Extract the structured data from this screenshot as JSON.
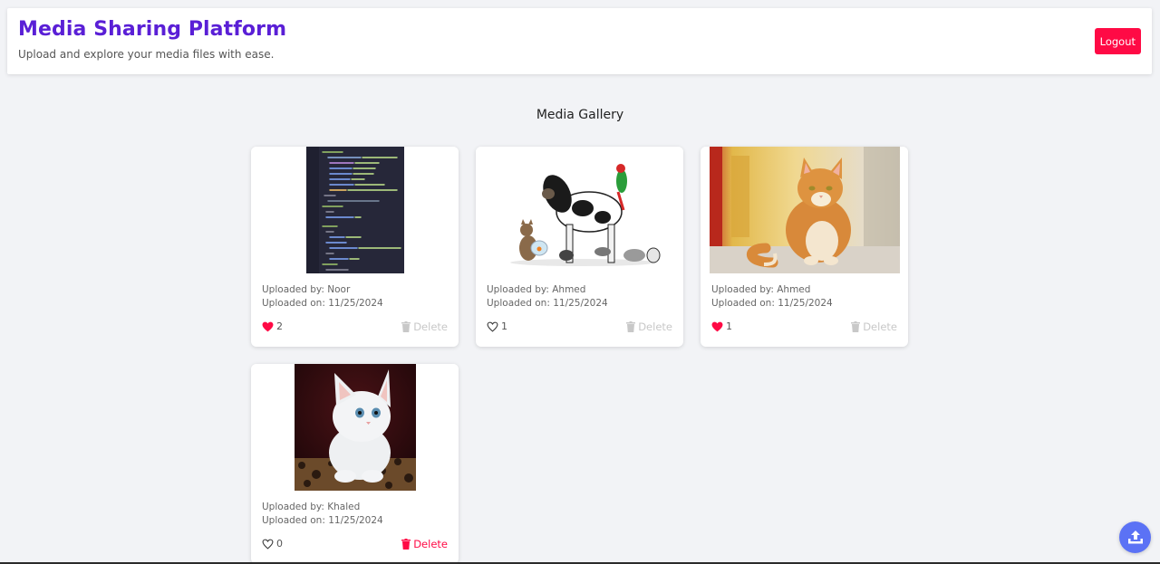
{
  "header": {
    "title": "Media Sharing Platform",
    "subtitle": "Upload and explore your media files with ease.",
    "logout_label": "Logout"
  },
  "gallery": {
    "title": "Media Gallery",
    "items": [
      {
        "uploaded_by": "Uploaded by: Noor",
        "uploaded_on": "Uploaded on: 11/25/2024",
        "likes": "2",
        "liked": true,
        "delete_label": "Delete",
        "can_delete": false,
        "image": "code-screenshot"
      },
      {
        "uploaded_by": "Uploaded by: Ahmed",
        "uploaded_on": "Uploaded on: 11/25/2024",
        "likes": "1",
        "liked": false,
        "delete_label": "Delete",
        "can_delete": false,
        "image": "pets-group-photo"
      },
      {
        "uploaded_by": "Uploaded by: Ahmed",
        "uploaded_on": "Uploaded on: 11/25/2024",
        "likes": "1",
        "liked": true,
        "delete_label": "Delete",
        "can_delete": false,
        "image": "orange-cat-photo"
      },
      {
        "uploaded_by": "Uploaded by: Khaled",
        "uploaded_on": "Uploaded on: 11/25/2024",
        "likes": "0",
        "liked": false,
        "delete_label": "Delete",
        "can_delete": true,
        "image": "white-kitten-photo"
      }
    ]
  },
  "colors": {
    "brand": "#5a1fd6",
    "danger": "#ff0a45",
    "fab": "#5b72f5",
    "background": "#f2f3f6"
  },
  "icons": {
    "like": "heart-icon",
    "delete": "trash-icon",
    "upload": "upload-icon"
  }
}
